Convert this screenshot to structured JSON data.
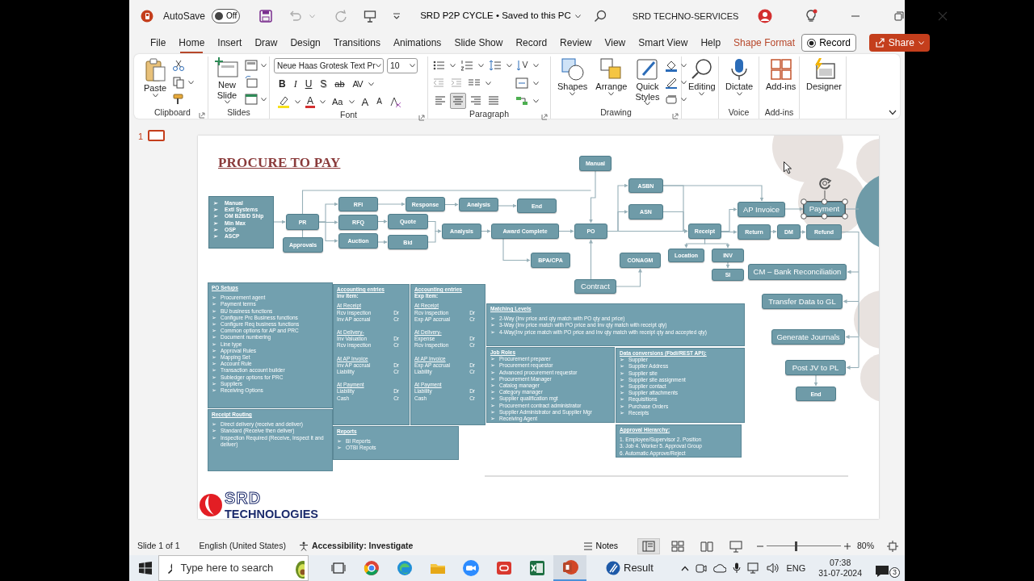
{
  "window": {
    "title": "SRD P2P CYCLE • Saved to this PC",
    "autosave": {
      "label": "AutoSave",
      "on": false,
      "state_text": "Off"
    },
    "account": "SRD TECHNO-SERVICES"
  },
  "tabs": [
    {
      "label": "File",
      "selected": false,
      "kind": "plain"
    },
    {
      "label": "Home",
      "selected": true,
      "kind": "plain"
    },
    {
      "label": "Insert",
      "selected": false,
      "kind": "plain"
    },
    {
      "label": "Draw",
      "selected": false,
      "kind": "plain"
    },
    {
      "label": "Design",
      "selected": false,
      "kind": "plain"
    },
    {
      "label": "Transitions",
      "selected": false,
      "kind": "plain"
    },
    {
      "label": "Animations",
      "selected": false,
      "kind": "plain"
    },
    {
      "label": "Slide Show",
      "selected": false,
      "kind": "plain"
    },
    {
      "label": "Record",
      "selected": false,
      "kind": "plain"
    },
    {
      "label": "Review",
      "selected": false,
      "kind": "plain"
    },
    {
      "label": "View",
      "selected": false,
      "kind": "plain"
    },
    {
      "label": "Smart View",
      "selected": false,
      "kind": "plain"
    },
    {
      "label": "Help",
      "selected": false,
      "kind": "plain"
    },
    {
      "label": "Shape Format",
      "selected": false,
      "kind": "contextual"
    }
  ],
  "header_buttons": {
    "record": "Record",
    "share": "Share"
  },
  "ribbon": {
    "groups": [
      {
        "kind": "clipboard",
        "label": "Clipboard",
        "buttons": [
          "Paste"
        ]
      },
      {
        "kind": "slides",
        "label": "Slides",
        "buttons": [
          "New Slide"
        ]
      },
      {
        "kind": "font",
        "label": "Font",
        "font_name": "Neue Haas Grotesk Text Pr",
        "font_size": "10",
        "buttons": [
          {
            "text": "B",
            "kind": "bold"
          },
          {
            "text": "I",
            "kind": "italic"
          },
          {
            "text": "U",
            "kind": "underline"
          },
          {
            "text": "S",
            "kind": "shadow"
          },
          {
            "text": "ab",
            "kind": "strike"
          },
          {
            "text": "AV",
            "kind": "spacing"
          },
          {
            "text": "A",
            "kind": "color"
          },
          {
            "text": "Aa",
            "kind": "case"
          },
          {
            "text": "A",
            "kind": "grow"
          },
          {
            "text": "A",
            "kind": "shrink"
          }
        ]
      },
      {
        "kind": "paragraph",
        "label": "Paragraph",
        "alignments": [
          {
            "kind": "left",
            "selected": false
          },
          {
            "kind": "center",
            "selected": true
          },
          {
            "kind": "right",
            "selected": false
          },
          {
            "kind": "justify",
            "selected": false
          }
        ]
      },
      {
        "kind": "drawing",
        "label": "Drawing",
        "buttons": [
          "Shapes",
          "Arrange",
          "Quick Styles"
        ]
      },
      {
        "kind": "editing",
        "buttons": [
          "Editing"
        ]
      },
      {
        "kind": "voice",
        "label": "Voice",
        "buttons": [
          "Dictate"
        ]
      },
      {
        "kind": "addins",
        "label": "Add-ins",
        "buttons": [
          "Add-ins"
        ]
      },
      {
        "kind": "designer",
        "buttons": [
          "Designer"
        ]
      }
    ]
  },
  "slide_panel": {
    "number": "1",
    "selected": true
  },
  "slide": {
    "title": "PROCURE TO PAY",
    "sources": {
      "bullet": "➢",
      "items": [
        "Manual",
        "Extl Systems",
        "OM B2B/D Ship",
        "Min Max",
        "OSP",
        "ASCP"
      ]
    },
    "nodes": [
      {
        "text": "Manual",
        "kind": "step",
        "selected": false
      },
      {
        "text": "ASBN",
        "kind": "step",
        "selected": false
      },
      {
        "text": "PR",
        "kind": "step",
        "selected": false
      },
      {
        "text": "RFI",
        "kind": "step",
        "selected": false
      },
      {
        "text": "Response",
        "kind": "step",
        "selected": false
      },
      {
        "text": "Analysis",
        "kind": "step",
        "selected": false
      },
      {
        "text": "End",
        "kind": "step",
        "selected": false
      },
      {
        "text": "RFQ",
        "kind": "step",
        "selected": false
      },
      {
        "text": "Quote",
        "kind": "step",
        "selected": false
      },
      {
        "text": "Approvals",
        "kind": "step",
        "selected": false
      },
      {
        "text": "Auction",
        "kind": "step",
        "selected": false
      },
      {
        "text": "Bid",
        "kind": "step",
        "selected": false
      },
      {
        "text": "Analysis",
        "kind": "step",
        "selected": false
      },
      {
        "text": "Award Complete",
        "kind": "step",
        "selected": false
      },
      {
        "text": "PO",
        "kind": "step",
        "selected": false
      },
      {
        "text": "ASN",
        "kind": "step",
        "selected": false
      },
      {
        "text": "AP Invoice",
        "kind": "major",
        "selected": false
      },
      {
        "text": "Payment",
        "kind": "major",
        "selected": true
      },
      {
        "text": "Receipt",
        "kind": "step",
        "selected": false
      },
      {
        "text": "Return",
        "kind": "step",
        "selected": false
      },
      {
        "text": "DM",
        "kind": "step",
        "selected": false
      },
      {
        "text": "Refund",
        "kind": "step",
        "selected": false
      },
      {
        "text": "BPA/CPA",
        "kind": "step",
        "selected": false
      },
      {
        "text": "CONAGM",
        "kind": "step",
        "selected": false
      },
      {
        "text": "Location",
        "kind": "step",
        "selected": false
      },
      {
        "text": "INV",
        "kind": "step",
        "selected": false
      },
      {
        "text": "SI",
        "kind": "step",
        "selected": false
      },
      {
        "text": "CM – Bank Reconciliation",
        "kind": "major",
        "selected": false
      },
      {
        "text": "Contract",
        "kind": "major",
        "selected": false
      },
      {
        "text": "Transfer Data to GL",
        "kind": "major",
        "selected": false
      },
      {
        "text": "Generate Journals",
        "kind": "major",
        "selected": false
      },
      {
        "text": "Post JV to PL",
        "kind": "major",
        "selected": false
      },
      {
        "text": "End",
        "kind": "step",
        "selected": false
      }
    ],
    "panels": [
      {
        "bullet": "➢",
        "lines": [
          {
            "kind": "title",
            "text": "PO Setups"
          },
          {
            "kind": "bullet",
            "text": "Procurement agent"
          },
          {
            "kind": "bullet",
            "text": "Payment terms"
          },
          {
            "kind": "bullet",
            "text": "BU business functions"
          },
          {
            "kind": "bullet",
            "text": "Configure Prc Business functions"
          },
          {
            "kind": "bullet",
            "text": "Configure Req business functions"
          },
          {
            "kind": "bullet",
            "text": "Common options for AP and PRC"
          },
          {
            "kind": "bullet",
            "text": "Document numbering"
          },
          {
            "kind": "bullet",
            "text": "Line type"
          },
          {
            "kind": "bullet",
            "text": "Approval Rules"
          },
          {
            "kind": "bullet",
            "text": "Mapping Set"
          },
          {
            "kind": "bullet",
            "text": "Account Rule"
          },
          {
            "kind": "bullet",
            "text": "Transaction account builder"
          },
          {
            "kind": "bullet",
            "text": "Subledger options for PRC"
          },
          {
            "kind": "bullet",
            "text": "Suppliers"
          },
          {
            "kind": "bullet",
            "text": "Receiving Options"
          }
        ]
      },
      {
        "bullet": "➢",
        "lines": [
          {
            "kind": "title",
            "text": "Receipt Routing"
          },
          {
            "kind": "bullet",
            "text": "Direct delivery (receive and deliver)"
          },
          {
            "kind": "bullet",
            "text": "Standard (Receive then deliver)"
          },
          {
            "kind": "bullet",
            "text": "Inspection Required (Receive, Inspect it and deliver)"
          }
        ]
      },
      {
        "lines": [
          {
            "kind": "title",
            "text": "Accounting entries"
          },
          {
            "kind": "label",
            "text": "Inv Item:"
          },
          {
            "kind": "section",
            "text": "At Receipt"
          },
          {
            "kind": "entry",
            "text": "Rcv inspection",
            "side": "Dr"
          },
          {
            "kind": "entry",
            "text": "Inv AP accrual",
            "side": "Cr"
          },
          {
            "kind": "section",
            "text": "At Delivery-"
          },
          {
            "kind": "entry",
            "text": "Inv Valuation",
            "side": "Dr"
          },
          {
            "kind": "entry",
            "text": "Rcv inspection",
            "side": "Cr"
          },
          {
            "kind": "section",
            "text": "At AP Invoice"
          },
          {
            "kind": "entry",
            "text": "Inv AP accrual",
            "side": "Dr"
          },
          {
            "kind": "entry",
            "text": "Liability",
            "side": "Cr"
          },
          {
            "kind": "section",
            "text": "At Payment"
          },
          {
            "kind": "entry",
            "text": "Liability",
            "side": "Dr"
          },
          {
            "kind": "entry",
            "text": "Cash",
            "side": "Cr"
          }
        ]
      },
      {
        "lines": [
          {
            "kind": "title",
            "text": "Accounting entries"
          },
          {
            "kind": "label",
            "text": "Exp Item:"
          },
          {
            "kind": "section",
            "text": "At Receipt"
          },
          {
            "kind": "entry",
            "text": "Rcv inspection",
            "side": "Dr"
          },
          {
            "kind": "entry",
            "text": "Exp AP accrual",
            "side": "Cr"
          },
          {
            "kind": "section",
            "text": "At Delivery-"
          },
          {
            "kind": "entry",
            "text": "Expense",
            "side": "Dr"
          },
          {
            "kind": "entry",
            "text": "Rcv inspection",
            "side": "Cr"
          },
          {
            "kind": "section",
            "text": "At AP Invoice"
          },
          {
            "kind": "entry",
            "text": "Exp AP accrual",
            "side": "Dr"
          },
          {
            "kind": "entry",
            "text": "Liability",
            "side": "Cr"
          },
          {
            "kind": "section",
            "text": "At Payment"
          },
          {
            "kind": "entry",
            "text": "Liability",
            "side": "Dr"
          },
          {
            "kind": "entry",
            "text": "Cash",
            "side": "Cr"
          }
        ]
      },
      {
        "bullet": "➢",
        "lines": [
          {
            "kind": "title",
            "text": "Reports"
          },
          {
            "kind": "bullet",
            "text": "BI Reports"
          },
          {
            "kind": "bullet",
            "text": "OTBI Repots"
          }
        ]
      },
      {
        "bullet": "➢",
        "lines": [
          {
            "kind": "title",
            "text": "Matching Levels"
          },
          {
            "kind": "bullet",
            "text": "2-Way (Inv price and qty match with PO qty and price)"
          },
          {
            "kind": "bullet",
            "text": "3-Way (Inv price match with PO price and Inv qty match with receipt qty)"
          },
          {
            "kind": "bullet",
            "text": "4-Way(Inv price match with PO price and Inv qty match with receipt qty and accepted qty)"
          }
        ]
      },
      {
        "bullet": "➢",
        "lines": [
          {
            "kind": "title",
            "text": "Job Roles"
          },
          {
            "kind": "bullet",
            "text": "Procurement preparer"
          },
          {
            "kind": "bullet",
            "text": "Procurement requestor"
          },
          {
            "kind": "bullet",
            "text": "Advanced procurement requestor"
          },
          {
            "kind": "bullet",
            "text": "Procurement Manager"
          },
          {
            "kind": "bullet",
            "text": "Catalog manager"
          },
          {
            "kind": "bullet",
            "text": "Category manager"
          },
          {
            "kind": "bullet",
            "text": "Supplier qualification mgt"
          },
          {
            "kind": "bullet",
            "text": "Procurement contract administrator"
          },
          {
            "kind": "bullet",
            "text": "Supplier Administrator and Supplier Mgr"
          },
          {
            "kind": "bullet",
            "text": "Receiving Agent"
          }
        ]
      },
      {
        "bullet": "➢",
        "lines": [
          {
            "kind": "title",
            "text": "Data conversions (Fbdi/REST API):"
          },
          {
            "kind": "bullet",
            "text": "Supplier"
          },
          {
            "kind": "bullet",
            "text": "Supplier Address"
          },
          {
            "kind": "bullet",
            "text": "Supplier site"
          },
          {
            "kind": "bullet",
            "text": "Supplier site assignment"
          },
          {
            "kind": "bullet",
            "text": "Supplier contact"
          },
          {
            "kind": "bullet",
            "text": "Supplier attachments"
          },
          {
            "kind": "bullet",
            "text": "Requisitions"
          },
          {
            "kind": "bullet",
            "text": "Purchase Orders"
          },
          {
            "kind": "bullet",
            "text": "Receipts"
          }
        ]
      },
      {
        "lines": [
          {
            "kind": "title",
            "text": "Approval Hierarchy:"
          },
          {
            "kind": "text",
            "text": "1. Employee/Supervisor 2. Position"
          },
          {
            "kind": "text",
            "text": "3. Job 4. Worker 5. Approval Group"
          },
          {
            "kind": "text",
            "text": "6. Automatic Approve/Reject"
          }
        ]
      }
    ],
    "logo": {
      "name": "SRD",
      "tagline": "TECHNOLOGIES"
    }
  },
  "status_bar": {
    "slide": "Slide 1 of 1",
    "language": "English (United States)",
    "accessibility": "Accessibility: Investigate",
    "notes": "Notes",
    "views": [
      {
        "kind": "normal",
        "selected": true
      },
      {
        "kind": "sorter",
        "selected": false
      },
      {
        "kind": "reading",
        "selected": false
      },
      {
        "kind": "slideshow",
        "selected": false
      }
    ],
    "zoom_slider": {
      "level": 0.38
    },
    "zoom": "80%"
  },
  "taskbar": {
    "search_placeholder": "Type here to search",
    "apps": [
      {
        "kind": "chrome",
        "selected": false
      },
      {
        "kind": "edge",
        "selected": false
      },
      {
        "kind": "folder",
        "selected": false
      },
      {
        "kind": "zoom",
        "selected": false
      },
      {
        "kind": "red",
        "selected": false
      },
      {
        "kind": "excel",
        "selected": false
      },
      {
        "kind": "powerpoint",
        "selected": true
      }
    ],
    "news": "Result",
    "language": "ENG",
    "time": "07:38",
    "date": "31-07-2024",
    "notifications": "3"
  }
}
